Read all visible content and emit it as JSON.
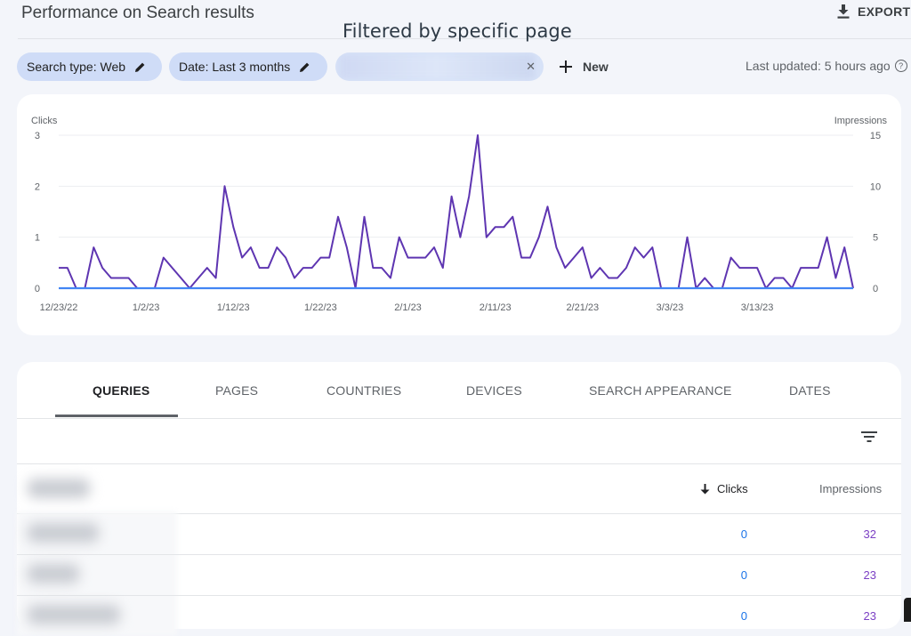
{
  "header": {
    "title": "Performance on Search results",
    "export_label": "EXPORT"
  },
  "annotation": "Filtered by specific page",
  "filters": {
    "search_type": "Search type: Web",
    "date": "Date: Last 3 months",
    "new_label": "New",
    "last_updated": "Last updated: 5 hours ago"
  },
  "chart_data": {
    "type": "line",
    "x_tick_labels": [
      "12/23/22",
      "1/2/23",
      "1/12/23",
      "1/22/23",
      "2/1/23",
      "2/11/23",
      "2/21/23",
      "3/3/23",
      "3/13/23"
    ],
    "left_axis": {
      "label": "Clicks",
      "ylim": [
        0,
        3
      ],
      "ticks": [
        0,
        1,
        2,
        3
      ]
    },
    "right_axis": {
      "label": "Impressions",
      "ylim": [
        0,
        15
      ],
      "ticks": [
        0,
        5,
        10,
        15
      ]
    },
    "x_start": "12/23/22",
    "x_end": "3/21/23",
    "grid": true,
    "series": [
      {
        "name": "Impressions",
        "axis": "right",
        "color": "#5e35b1",
        "values": [
          2,
          2,
          0,
          0,
          4,
          2,
          1,
          1,
          1,
          0,
          0,
          0,
          3,
          2,
          1,
          0,
          1,
          2,
          1,
          10,
          6,
          3,
          4,
          2,
          2,
          4,
          3,
          1,
          2,
          2,
          3,
          3,
          7,
          4,
          0,
          7,
          2,
          2,
          1,
          5,
          3,
          3,
          3,
          4,
          2,
          9,
          5,
          9,
          15,
          5,
          6,
          6,
          7,
          3,
          3,
          5,
          8,
          4,
          2,
          3,
          4,
          1,
          2,
          1,
          1,
          2,
          4,
          3,
          4,
          0,
          0,
          0,
          5,
          0,
          1,
          0,
          0,
          3,
          2,
          2,
          2,
          0,
          1,
          1,
          0,
          2,
          2,
          2,
          5,
          1,
          4,
          0
        ]
      },
      {
        "name": "Clicks",
        "axis": "left",
        "color": "#4285f4",
        "values": [
          0,
          0,
          0,
          0,
          0,
          0,
          0,
          0,
          0,
          0,
          0,
          0,
          0,
          0,
          0,
          0,
          0,
          0,
          0,
          0,
          0,
          0,
          0,
          0,
          0,
          0,
          0,
          0,
          0,
          0,
          0,
          0,
          0,
          0,
          0,
          0,
          0,
          0,
          0,
          0,
          0,
          0,
          0,
          0,
          0,
          0,
          0,
          0,
          0,
          0,
          0,
          0,
          0,
          0,
          0,
          0,
          0,
          0,
          0,
          0,
          0,
          0,
          0,
          0,
          0,
          0,
          0,
          0,
          0,
          0,
          0,
          0,
          0,
          0,
          0,
          0,
          0,
          0,
          0,
          0,
          0,
          0,
          0,
          0,
          0,
          0,
          0,
          0,
          0,
          0,
          0,
          0
        ]
      }
    ]
  },
  "tabs": [
    {
      "label": "QUERIES",
      "active": true
    },
    {
      "label": "PAGES",
      "active": false
    },
    {
      "label": "COUNTRIES",
      "active": false
    },
    {
      "label": "DEVICES",
      "active": false
    },
    {
      "label": "SEARCH APPEARANCE",
      "active": false
    },
    {
      "label": "DATES",
      "active": false
    }
  ],
  "table": {
    "columns": {
      "clicks": "Clicks",
      "impressions": "Impressions"
    },
    "sort": "clicks-descending",
    "rows": [
      {
        "clicks": "0",
        "impressions": "32"
      },
      {
        "clicks": "0",
        "impressions": "23"
      },
      {
        "clicks": "0",
        "impressions": "23"
      }
    ]
  },
  "colors": {
    "chip_background": "#cfdcf7",
    "impressions_line": "#5e35b1",
    "clicks_line": "#4285f4",
    "clicks_value": "#1a73e8",
    "impressions_value": "#7b3fc4"
  }
}
